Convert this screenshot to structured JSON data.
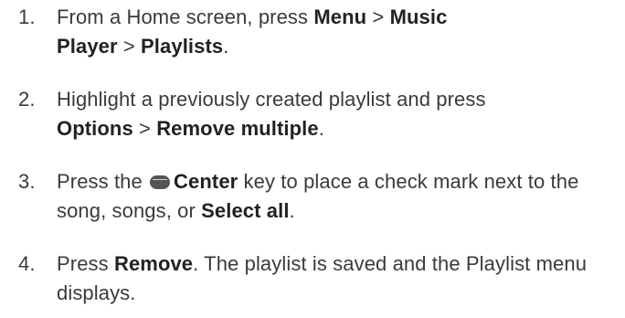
{
  "steps": [
    {
      "num": "1.",
      "parts": [
        "From a Home screen, press ",
        "Menu",
        " > ",
        "Music",
        " ",
        "Player",
        " > ",
        "Playlists",
        "."
      ]
    },
    {
      "num": "2.",
      "parts": [
        "Highlight a previously created playlist and press ",
        "Options",
        " > ",
        "Remove multiple",
        "."
      ]
    },
    {
      "num": "3.",
      "icon": "center-key-icon",
      "parts": [
        "Press the ",
        "Center",
        " key to place a check mark next to the song, songs, or ",
        "Select all",
        "."
      ]
    },
    {
      "num": "4.",
      "parts": [
        "Press ",
        "Remove",
        ". The playlist is saved and the Playlist menu displays."
      ]
    }
  ]
}
